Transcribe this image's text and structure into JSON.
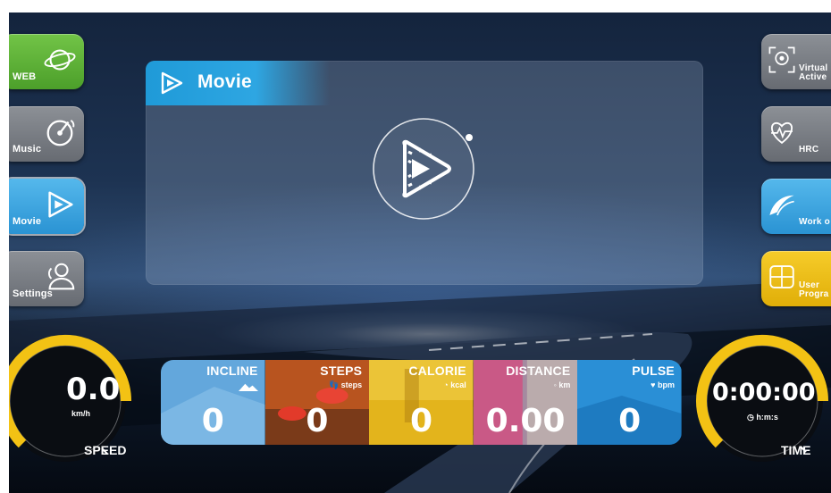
{
  "left_menu": [
    {
      "label": "WEB",
      "icon": "web-icon",
      "color": "#58b233"
    },
    {
      "label": "Music",
      "icon": "music-icon",
      "color": "#7b7f85"
    },
    {
      "label": "Movie",
      "icon": "movie-icon",
      "color": "#3aa6e0"
    },
    {
      "label": "Settings",
      "icon": "settings-icon",
      "color": "#7b7f85"
    }
  ],
  "right_menu": [
    {
      "label_line1": "Virtual",
      "label_line2": "Active",
      "icon": "virtual-active-icon",
      "color": "#7b7f85"
    },
    {
      "label_line1": "",
      "label_line2": "HRC",
      "icon": "heart-pulse-icon",
      "color": "#7b7f85"
    },
    {
      "label_line1": "",
      "label_line2": "Work o",
      "icon": "workout-icon",
      "color": "#3aa6e0"
    },
    {
      "label_line1": "User",
      "label_line2": "Progra",
      "icon": "user-program-icon",
      "color": "#f2c00f"
    }
  ],
  "panel": {
    "title": "Movie",
    "header_color": "#1f9ad8"
  },
  "speed": {
    "value": "0.0",
    "unit": "km/h",
    "title": "SPEED",
    "ring_color": "#f3c214"
  },
  "time": {
    "value": "0:00:00",
    "unit": "h:m:s",
    "title": "TIME",
    "ring_color": "#f3c214"
  },
  "stats": [
    {
      "label": "INCLINE",
      "unit": "",
      "value": "0",
      "icon": "incline-icon",
      "color": "#63a7dc"
    },
    {
      "label": "STEPS",
      "unit": "steps",
      "value": "0",
      "icon": "footprint-icon",
      "color": "#b8541f"
    },
    {
      "label": "CALORIE",
      "unit": "kcal",
      "value": "0",
      "icon": "flame-icon",
      "color": "#e3b41c"
    },
    {
      "label": "DISTANCE",
      "unit": "km",
      "value": "0.00",
      "icon": "distance-icon",
      "color": "#a48aa0"
    },
    {
      "label": "PULSE",
      "unit": "bpm",
      "value": "0",
      "icon": "heart-icon",
      "color": "#2a8fd6"
    }
  ]
}
